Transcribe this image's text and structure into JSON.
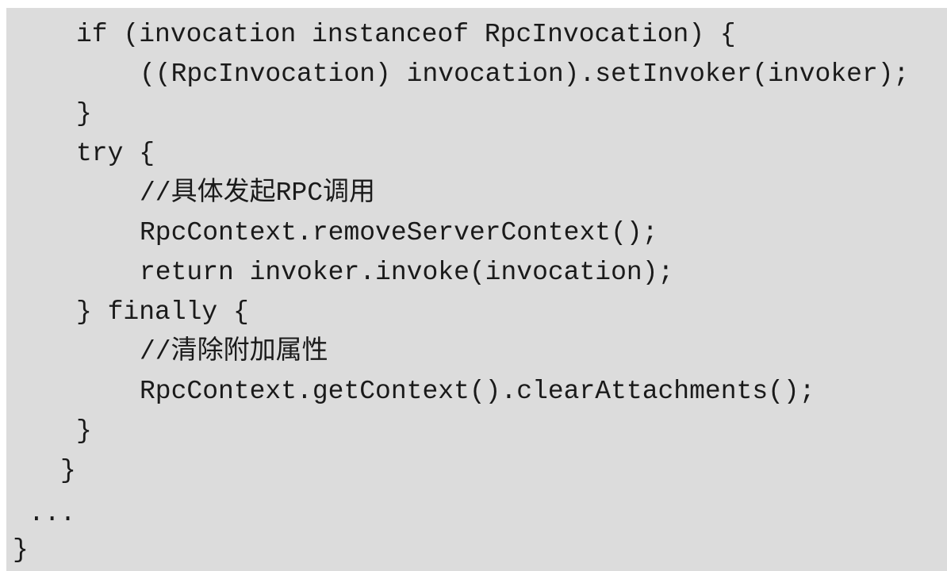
{
  "code": {
    "lines": [
      "if (invocation instanceof RpcInvocation) {",
      "((RpcInvocation) invocation).setInvoker(invoker);",
      "}",
      "try {",
      "//具体发起RPC调用",
      "RpcContext.removeServerContext();",
      "return invoker.invoke(invocation);",
      "} finally {",
      "//清除附加属性",
      "RpcContext.getContext().clearAttachments();",
      "}",
      "}",
      "...",
      "}"
    ]
  }
}
